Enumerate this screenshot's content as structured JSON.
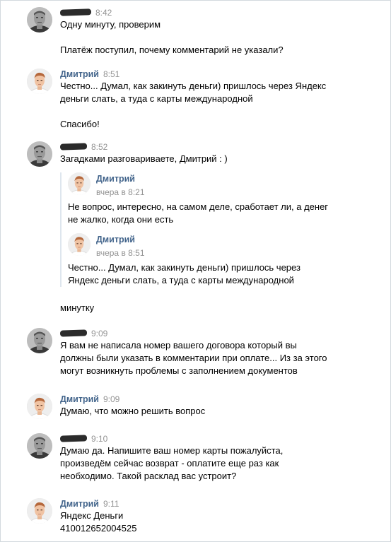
{
  "messages": [
    {
      "author": "",
      "redacted_author": true,
      "time": "8:42",
      "avatar": "man-avatar",
      "paragraphs": [
        "Одну минуту, проверим",
        "Платёж поступил, почему комментарий не указали?"
      ]
    },
    {
      "author": "Дмитрий",
      "redacted_author": false,
      "time": "8:51",
      "avatar": "dmitry-avatar",
      "paragraphs": [
        "Честно... Думал, как закинуть деньги) пришлось через Яндекс\nденьги слать, а туда с карты международной",
        "Спасибо!"
      ]
    },
    {
      "author": "",
      "redacted_author": true,
      "time": "8:52",
      "avatar": "man-avatar",
      "paragraphs": [
        "Загадками разговариваете, Дмитрий : )"
      ],
      "forwarded": [
        {
          "author": "Дмитрий",
          "time": "вчера в 8:21",
          "text": "Не вопрос, интересно, на самом деле, сработает ли, а денег\nне жалко, когда они есть"
        },
        {
          "author": "Дмитрий",
          "time": "вчера в 8:51",
          "text": "Честно... Думал, как закинуть деньги) пришлось через\nЯндекс деньги слать, а туда с карты международной"
        }
      ],
      "after_forward": "минутку"
    },
    {
      "author": "",
      "redacted_author": true,
      "time": "9:09",
      "avatar": "man-avatar",
      "paragraphs": [
        "Я вам не написала номер вашего договора который вы\nдолжны были указать в комментарии при оплате... Из за этого\nмогут возникнуть проблемы с заполнением документов"
      ]
    },
    {
      "author": "Дмитрий",
      "redacted_author": false,
      "time": "9:09",
      "avatar": "dmitry-avatar",
      "paragraphs": [
        "Думаю, что можно решить вопрос"
      ]
    },
    {
      "author": "",
      "redacted_author": true,
      "time": "9:10",
      "avatar": "man-avatar",
      "paragraphs": [
        "Думаю да. Напишите ваш номер карты пожалуйста,\nпроизведём сейчас возврат - оплатите еще раз как\nнеобходимо. Такой расклад вас устроит?"
      ]
    },
    {
      "author": "Дмитрий",
      "redacted_author": false,
      "time": "9:11",
      "avatar": "dmitry-avatar",
      "paragraphs": [
        "Яндекс Деньги\n410012652004525"
      ]
    }
  ],
  "colors": {
    "author": "#42648b",
    "time": "#939393",
    "forward_bar": "#dee6ee",
    "redaction": "#2b2b2b"
  }
}
